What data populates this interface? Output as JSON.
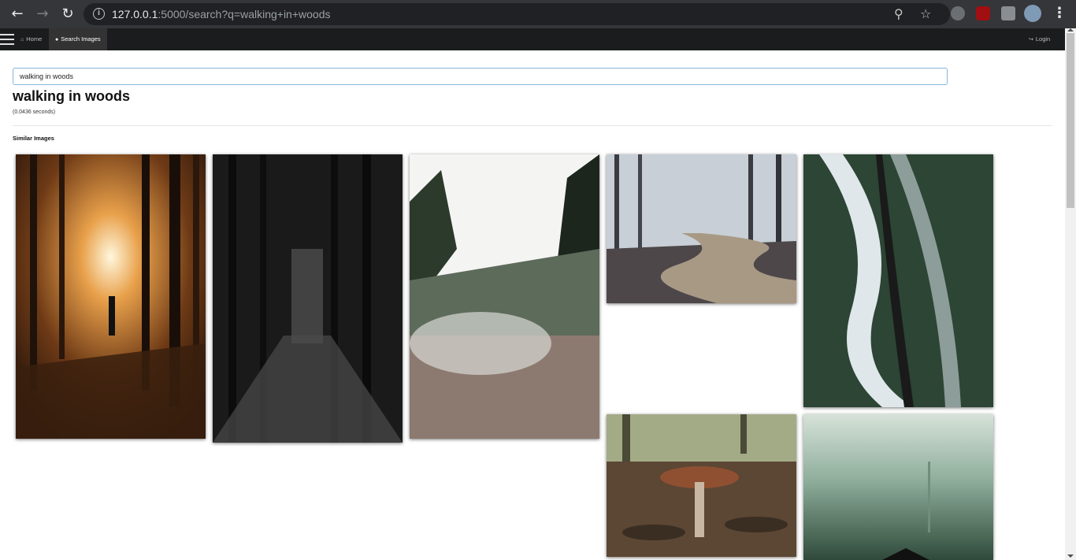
{
  "browser": {
    "url_host": "127.0.0.1",
    "url_rest": ":5000/search?q=walking+in+woods",
    "back_icon": "arrow-left-icon",
    "forward_icon": "arrow-right-icon",
    "reload_icon": "reload-icon"
  },
  "navbar": {
    "home_label": "Home",
    "search_images_label": "Search Images",
    "login_label": "Login"
  },
  "search": {
    "value": "walking in woods",
    "title": "walking in woods",
    "timing": "(0.0436 seconds)"
  },
  "results": {
    "section_title": "Similar Images",
    "images": [
      {
        "desc": "forest sunset walker",
        "colors": [
          "#f6e3b5",
          "#c9762e",
          "#5a3218",
          "#2a160b"
        ]
      },
      {
        "desc": "dark forest path",
        "colors": [
          "#3a3a3a",
          "#1c1c1c",
          "#6e6e6e",
          "#0e0e0e"
        ]
      },
      {
        "desc": "misty pine valley",
        "colors": [
          "#f2f2f0",
          "#9fa49c",
          "#3f4a3c",
          "#7e6b63"
        ]
      },
      {
        "desc": "frosty forest road",
        "colors": [
          "#c5ccd4",
          "#7a7c80",
          "#9b8c7b",
          "#4a4448"
        ]
      },
      {
        "desc": "aerial snowy road",
        "colors": [
          "#2f4a38",
          "#dde6ea",
          "#1e3326",
          "#1a1a1a"
        ]
      },
      {
        "desc": "mushroom forest floor",
        "colors": [
          "#9aa37a",
          "#6b5440",
          "#9a5b3a",
          "#3b2f25"
        ]
      },
      {
        "desc": "foggy green forest",
        "colors": [
          "#cfdcd2",
          "#8aa897",
          "#567a64",
          "#2f4a3a"
        ]
      }
    ]
  }
}
